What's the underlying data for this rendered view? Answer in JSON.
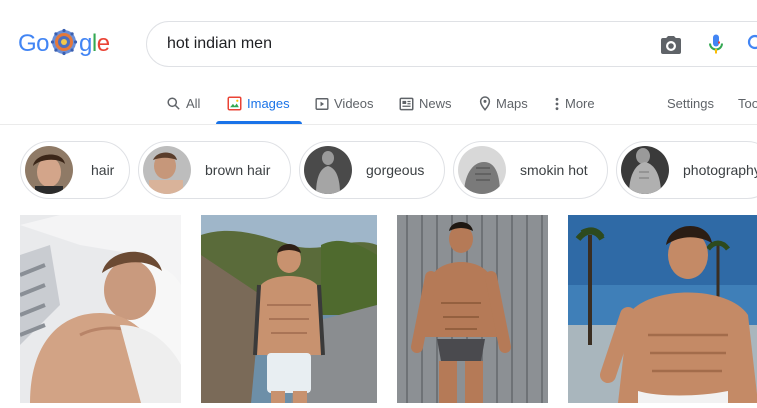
{
  "logo": {
    "text": "Google"
  },
  "search": {
    "query": "hot indian men"
  },
  "tabs": [
    {
      "label": "All",
      "icon": "search-icon"
    },
    {
      "label": "Images",
      "icon": "image-icon",
      "active": true
    },
    {
      "label": "Videos",
      "icon": "play-icon"
    },
    {
      "label": "News",
      "icon": "newspaper-icon"
    },
    {
      "label": "Maps",
      "icon": "map-pin-icon"
    },
    {
      "label": "More",
      "icon": "more-vert-icon"
    }
  ],
  "tools": {
    "settings": "Settings",
    "tools": "Tools"
  },
  "chips": [
    {
      "label": "hair"
    },
    {
      "label": "brown hair"
    },
    {
      "label": "gorgeous"
    },
    {
      "label": "smokin hot"
    },
    {
      "label": "photography"
    }
  ],
  "colors": {
    "accent": "#1a73e8",
    "google_blue": "#4285f4",
    "google_red": "#ea4335",
    "google_yellow": "#fbbc05",
    "google_green": "#34a853"
  }
}
